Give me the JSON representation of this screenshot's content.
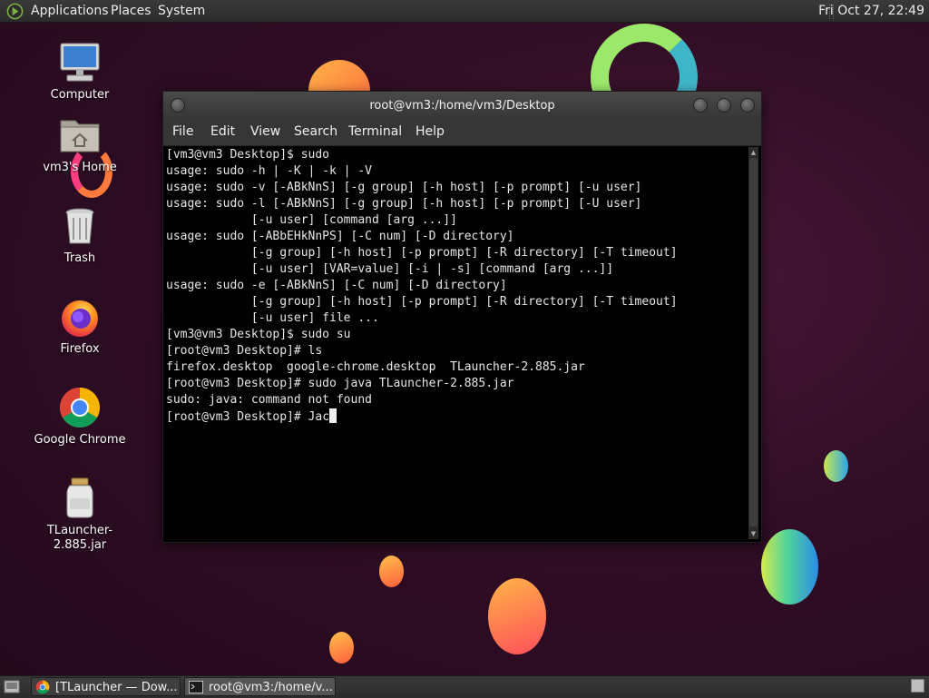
{
  "top_panel": {
    "menus": [
      "Applications",
      "Places",
      "System"
    ],
    "clock": "Fri Oct 27, 22:49"
  },
  "desktop_icons": [
    {
      "label": "Computer",
      "icon": "computer-icon"
    },
    {
      "label": "vm3's Home",
      "icon": "home-folder-icon"
    },
    {
      "label": "Trash",
      "icon": "trash-icon"
    },
    {
      "label": "Firefox",
      "icon": "firefox-icon"
    },
    {
      "label": "Google Chrome",
      "icon": "chrome-icon"
    },
    {
      "label": "TLauncher-2.885.jar",
      "icon": "jar-file-icon"
    }
  ],
  "terminal": {
    "title": "root@vm3:/home/vm3/Desktop",
    "menu": [
      "File",
      "Edit",
      "View",
      "Search",
      "Terminal",
      "Help"
    ],
    "lines": [
      "[vm3@vm3 Desktop]$ sudo",
      "usage: sudo -h | -K | -k | -V",
      "usage: sudo -v [-ABkNnS] [-g group] [-h host] [-p prompt] [-u user]",
      "usage: sudo -l [-ABkNnS] [-g group] [-h host] [-p prompt] [-U user]",
      "            [-u user] [command [arg ...]]",
      "usage: sudo [-ABbEHkNnPS] [-C num] [-D directory]",
      "            [-g group] [-h host] [-p prompt] [-R directory] [-T timeout]",
      "            [-u user] [VAR=value] [-i | -s] [command [arg ...]]",
      "usage: sudo -e [-ABkNnS] [-C num] [-D directory]",
      "            [-g group] [-h host] [-p prompt] [-R directory] [-T timeout]",
      "            [-u user] file ...",
      "[vm3@vm3 Desktop]$ sudo su",
      "[root@vm3 Desktop]# ls",
      "firefox.desktop  google-chrome.desktop  TLauncher-2.885.jar",
      "[root@vm3 Desktop]# sudo java TLauncher-2.885.jar",
      "sudo: java: command not found"
    ],
    "current_prompt": "[root@vm3 Desktop]# ",
    "current_input": "Jac"
  },
  "taskbar": {
    "tasks": [
      {
        "label": "[TLauncher — Dow...",
        "icon": "chrome-icon",
        "active": false
      },
      {
        "label": "root@vm3:/home/v...",
        "icon": "terminal-icon",
        "active": true
      }
    ]
  }
}
